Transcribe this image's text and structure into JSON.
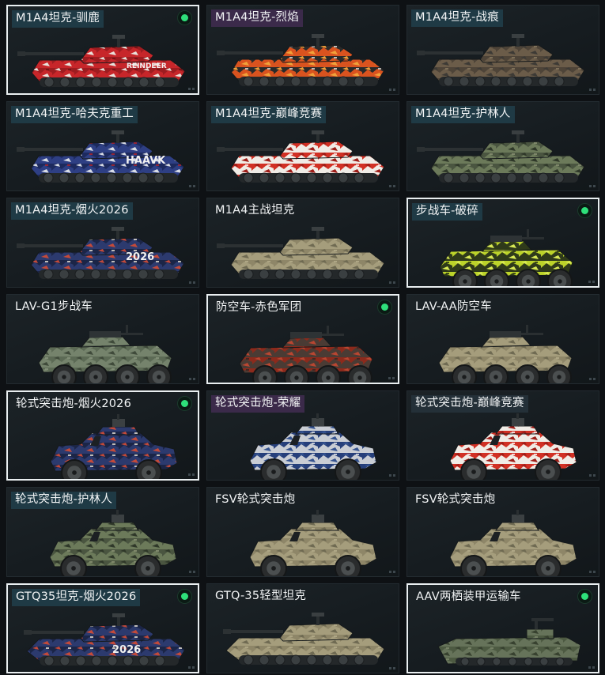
{
  "colors": {
    "selected_border": "#e9eef0",
    "equipped_dot": "#2ee07a",
    "card_background": "#181f23",
    "page_background": "#0e1114"
  },
  "skins": [
    {
      "label": "M1A4坦克-驯鹿",
      "tag": "teal",
      "kind": "tank",
      "selected": true,
      "equipped": true,
      "camo": "reindeer",
      "text": "REINDEER"
    },
    {
      "label": "M1A4坦克-烈焰",
      "tag": "purple",
      "kind": "tank",
      "selected": false,
      "equipped": false,
      "camo": "flame",
      "text": ""
    },
    {
      "label": "M1A4坦克-战痕",
      "tag": "teal",
      "kind": "tank",
      "selected": false,
      "equipped": false,
      "camo": "scar",
      "text": ""
    },
    {
      "label": "M1A4坦克-哈夫克重工",
      "tag": "teal",
      "kind": "tank",
      "selected": false,
      "equipped": false,
      "camo": "haavk",
      "text": "HAAVK"
    },
    {
      "label": "M1A4坦克-巅峰竞赛",
      "tag": "teal",
      "kind": "tank",
      "selected": false,
      "equipped": false,
      "camo": "race",
      "text": ""
    },
    {
      "label": "M1A4坦克-护林人",
      "tag": "teal",
      "kind": "tank",
      "selected": false,
      "equipped": false,
      "camo": "forest",
      "text": ""
    },
    {
      "label": "M1A4坦克-烟火2026",
      "tag": "teal",
      "kind": "tank",
      "selected": false,
      "equipped": false,
      "camo": "fireworks",
      "text": "2026"
    },
    {
      "label": "M1A4主战坦克",
      "tag": "none",
      "kind": "tank",
      "selected": false,
      "equipped": false,
      "camo": "tan",
      "text": ""
    },
    {
      "label": "步战车-破碎",
      "tag": "teal",
      "kind": "apc",
      "selected": true,
      "equipped": true,
      "camo": "shatter",
      "text": ""
    },
    {
      "label": "LAV-G1步战车",
      "tag": "none",
      "kind": "apc",
      "selected": false,
      "equipped": false,
      "camo": "green",
      "text": ""
    },
    {
      "label": "防空车-赤色军团",
      "tag": "none",
      "kind": "apc",
      "selected": true,
      "equipped": true,
      "camo": "redlegion",
      "text": ""
    },
    {
      "label": "LAV-AA防空车",
      "tag": "none",
      "kind": "apc",
      "selected": false,
      "equipped": false,
      "camo": "tan",
      "text": ""
    },
    {
      "label": "轮式突击炮-烟火2026",
      "tag": "none",
      "kind": "car",
      "selected": true,
      "equipped": true,
      "camo": "fireworks",
      "text": ""
    },
    {
      "label": "轮式突击炮-荣耀",
      "tag": "purple",
      "kind": "car",
      "selected": false,
      "equipped": false,
      "camo": "glory",
      "text": ""
    },
    {
      "label": "轮式突击炮-巅峰竞赛",
      "tag": "dark",
      "kind": "car",
      "selected": false,
      "equipped": false,
      "camo": "race",
      "text": ""
    },
    {
      "label": "轮式突击炮-护林人",
      "tag": "teal",
      "kind": "car",
      "selected": false,
      "equipped": false,
      "camo": "forest",
      "text": ""
    },
    {
      "label": "FSV轮式突击炮",
      "tag": "none",
      "kind": "car",
      "selected": false,
      "equipped": false,
      "camo": "tan",
      "text": ""
    },
    {
      "label": "FSV轮式突击炮",
      "tag": "none",
      "kind": "car",
      "selected": false,
      "equipped": false,
      "camo": "tan",
      "text": ""
    },
    {
      "label": "GTQ35坦克-烟火2026",
      "tag": "teal",
      "kind": "lighttank",
      "selected": true,
      "equipped": true,
      "camo": "fireworks",
      "text": "2026"
    },
    {
      "label": "GTQ-35轻型坦克",
      "tag": "none",
      "kind": "lighttank",
      "selected": false,
      "equipped": false,
      "camo": "tan",
      "text": ""
    },
    {
      "label": "AAV两栖装甲运输车",
      "tag": "none",
      "kind": "aav",
      "selected": true,
      "equipped": true,
      "camo": "olive",
      "text": ""
    }
  ]
}
